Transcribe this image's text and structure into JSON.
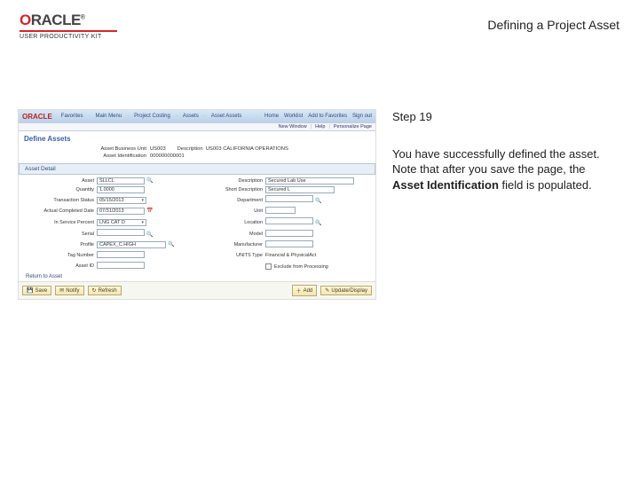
{
  "brand": {
    "letter": "O",
    "rest": "RACLE",
    "tm": "®",
    "sub": "USER PRODUCTIVITY KIT"
  },
  "page_title": "Defining a Project Asset",
  "nav": {
    "brand": "ORACLE",
    "items": [
      "Favorites",
      "Main Menu",
      "Project Costing",
      "Assets",
      "Asset Assets"
    ],
    "right": [
      "Home",
      "Worklist",
      "Add to Favorites",
      "Sign out"
    ]
  },
  "subbar": [
    "New Window",
    "Help",
    "Personalize Page"
  ],
  "form_title": "Define Assets",
  "header": {
    "bu_lbl": "Asset Business Unit",
    "bu_val": "US003",
    "desc_lbl": "Description",
    "desc_val": "US003 CALIFORNIA OPERATIONS",
    "id_lbl": "Asset Identification",
    "id_val": "000000000001"
  },
  "section": "Asset Detail",
  "fields": {
    "asset_name_lbl": "Asset",
    "asset_name_val": "SLLCL",
    "descr_lbl": "Description",
    "descr_val": "Secured Lab Use",
    "qty_lbl": "Quantity",
    "qty_val": "1.0000",
    "shortdesc_lbl": "Short Description",
    "shortdesc_val": "Secured L",
    "status_lbl": "Transaction Status",
    "status_val": "05/15/2013",
    "dept_lbl": "Department",
    "dept_val": "",
    "commdate_lbl": "Actual Completed Date",
    "commdate_val": "07/31/2013",
    "unit_lbl": "Unit",
    "unit_val": "",
    "inservice_lbl": "In Service Percent",
    "inservice_val": "LNG CAT D",
    "loc_lbl": "Location",
    "loc_val": "",
    "serial_lbl": "Serial",
    "serial_val": "",
    "model_lbl": "Model",
    "model_val": "",
    "profile_lbl": "Profile",
    "profile_val": "CAPEX_C.HIGH",
    "mfr_lbl": "Manufacturer",
    "mfr_val": "",
    "tag_lbl": "Tag Number",
    "tag_val": "",
    "unitstype_lbl": "UNITS Type",
    "unitstype_val": "Financial & PhysicalAct",
    "assetid_lbl": "Asset ID",
    "assetid_val": "",
    "exclude_lbl": "Exclude from Processing"
  },
  "return_link": "Return to Asset",
  "buttons": {
    "save": "Save",
    "notify": "Notify",
    "refresh": "Refresh",
    "add": "Add",
    "update": "Update/Display"
  },
  "step": {
    "num": "Step 19",
    "line1": "You have successfully defined the asset.",
    "line2a": "Note that after you save the page, the ",
    "line2b": "Asset Identification",
    "line2c": " field is populated."
  }
}
